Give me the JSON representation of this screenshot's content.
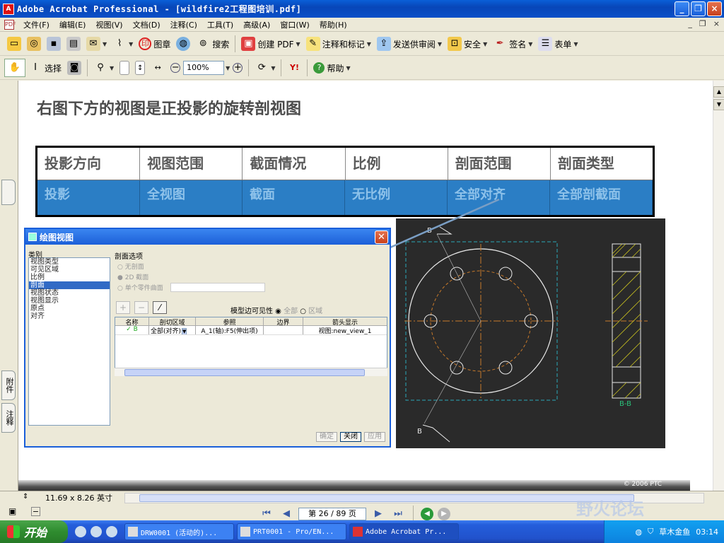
{
  "window": {
    "title": "Adobe Acrobat Professional - [wildfire2工程图培训.pdf]",
    "app_icon": "acrobat-icon",
    "controls": [
      "_",
      "❐",
      "×"
    ]
  },
  "menubar": {
    "items": [
      "文件(F)",
      "编辑(E)",
      "视图(V)",
      "文档(D)",
      "注释(C)",
      "工具(T)",
      "高级(A)",
      "窗口(W)",
      "帮助(H)"
    ],
    "mdi_controls": [
      "_",
      "❐",
      "×"
    ]
  },
  "toolbar1": {
    "stamp_label": "图章",
    "search_label": "搜索",
    "create_pdf_label": "创建 PDF",
    "comment_label": "注释和标记",
    "review_label": "发送供审阅",
    "security_label": "安全",
    "sign_label": "签名",
    "forms_label": "表单"
  },
  "toolbar2": {
    "select_label": "选择",
    "zoom_value": "100%",
    "help_label": "帮助",
    "yahoo_label": "Y!"
  },
  "navtabs": {
    "attachments": "附件",
    "comments": "注释"
  },
  "slide": {
    "title": "右图下方的视图是正投影的旋转剖视图",
    "table": {
      "headers": [
        "投影方向",
        "视图范围",
        "截面情况",
        "比例",
        "剖面范围",
        "剖面类型"
      ],
      "values": [
        "投影",
        "全视图",
        "截面",
        "无比例",
        "全部对齐",
        "全部剖截面"
      ]
    },
    "footer": "© 2006 PTC"
  },
  "dialog": {
    "title": "绘图视图",
    "category_label": "类别",
    "categories": [
      "视图类型",
      "可见区域",
      "比例",
      "剖面",
      "视图状态",
      "视图显示",
      "原点",
      "对齐"
    ],
    "selected_category": "剖面",
    "section_group": "剖面选项",
    "radio_options": [
      "无剖面",
      "2D 截面",
      "单个零件曲面"
    ],
    "model_edge_label": "模型边可见性",
    "model_edge_options": [
      "全部",
      "区域"
    ],
    "grid_headers": [
      "名称",
      "剖切区域",
      "参照",
      "边界",
      "箭头显示"
    ],
    "grid_row": [
      "B",
      "全部(对齐)",
      "A_1(轴):F5(伸出项)",
      "",
      "视图:new_view_1"
    ],
    "buttons": [
      "确定",
      "关闭",
      "应用"
    ]
  },
  "drawing": {
    "section_marker_top": "B",
    "section_marker_bottom": "B",
    "section_label": "B-B"
  },
  "statusbar": {
    "page_size": "11.69 x 8.26 英寸",
    "page_indicator": "第 26 / 89 页"
  },
  "taskbar": {
    "start_label": "开始",
    "tasks": [
      "DRW0001 (活动的)...",
      "PRT0001 - Pro/EN...",
      "Adobe Acrobat Pr..."
    ],
    "tray_text": "草木金鱼",
    "clock": "03:14"
  },
  "watermark": "野火论坛",
  "colors": {
    "title_bar": "#0a5fd8",
    "table_band": "#2b7ec5",
    "drawing_bg": "#2a2a2a",
    "start_green": "#2f8c2f"
  }
}
